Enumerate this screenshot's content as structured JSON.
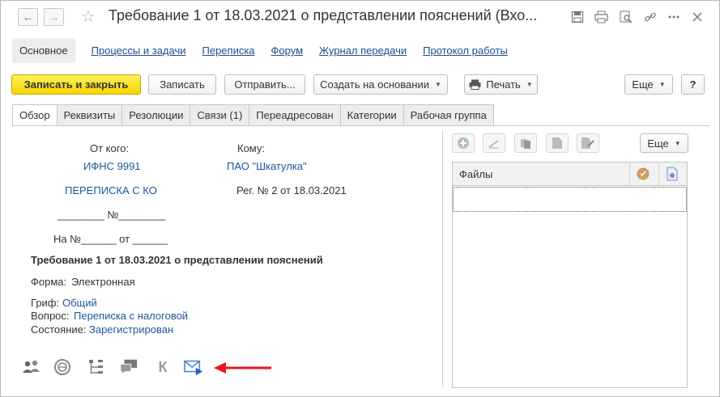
{
  "window": {
    "title": "Требование 1 от 18.03.2021 о представлении пояснений (Вхо..."
  },
  "section_nav": {
    "active": "Основное",
    "links": [
      "Процессы и задачи",
      "Переписка",
      "Форум",
      "Журнал передачи",
      "Протокол работы"
    ]
  },
  "toolbar": {
    "save_close": "Записать и закрыть",
    "save": "Записать",
    "send": "Отправить...",
    "create_based": "Создать на основании",
    "print": "Печать",
    "more": "Еще",
    "help": "?"
  },
  "tabs": [
    "Обзор",
    "Реквизиты",
    "Резолюции",
    "Связи (1)",
    "Переадресован",
    "Категории",
    "Рабочая группа"
  ],
  "overview": {
    "from_label": "От кого:",
    "from_org": "ИФНС 9991",
    "from_sub": "ПЕРЕПИСКА С КО",
    "number_line": "________ №________",
    "ref_line": "На №______ от ______",
    "to_label": "Кому:",
    "to_org": "ПАО \"Шкатулка\"",
    "reg_info": "Рег. № 2 от 18.03.2021",
    "subject": "Требование 1 от 18.03.2021 о представлении пояснений",
    "form_label": "Форма:",
    "form_value": "Электронная",
    "grif_label": "Гриф:",
    "grif_value": "Общий",
    "question_label": "Вопрос:",
    "question_value": "Переписка с налоговой",
    "state_label": "Состояние:",
    "state_value": "Зарегистрирован",
    "k_letter": "К"
  },
  "files_panel": {
    "more": "Еще",
    "column_files": "Файлы"
  },
  "colors": {
    "primary_button": "#f5d400",
    "link": "#1c5797",
    "arrow": "#e8161b"
  }
}
